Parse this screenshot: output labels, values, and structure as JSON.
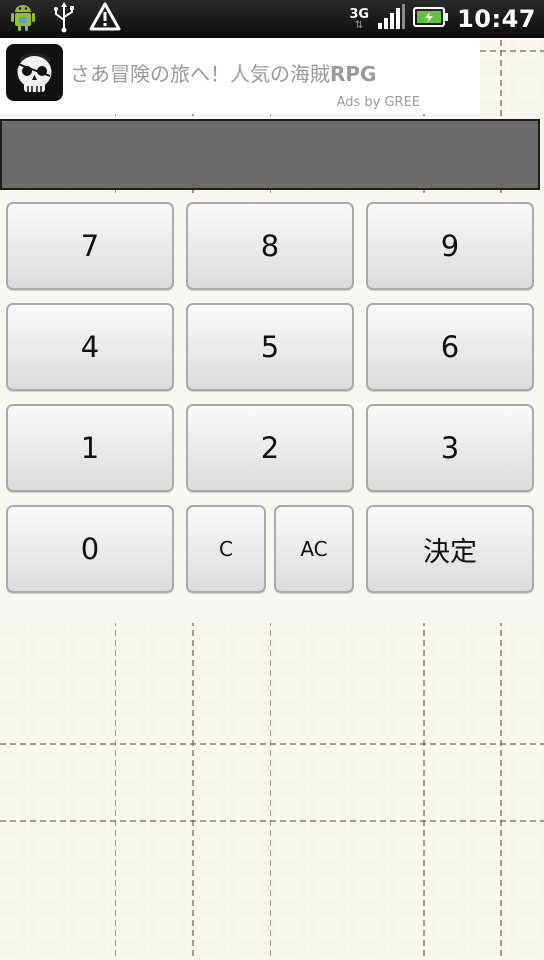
{
  "status_bar": {
    "time": "10:47",
    "network_type": "3G",
    "icons": [
      "android-icon",
      "usb-icon",
      "warning-icon",
      "signal-icon",
      "battery-charging-icon"
    ]
  },
  "ad": {
    "text_main": "さあ冒険の旅へ！人気の海賊",
    "text_bold": "RPG",
    "credit": "Ads by GREE",
    "logo": "pirate-skull-icon"
  },
  "display": {
    "value": ""
  },
  "keys": {
    "k7": "7",
    "k8": "8",
    "k9": "9",
    "k4": "4",
    "k5": "5",
    "k6": "6",
    "k1": "1",
    "k2": "2",
    "k3": "3",
    "k0": "0",
    "clear": "C",
    "all_clear": "AC",
    "confirm": "決定"
  }
}
